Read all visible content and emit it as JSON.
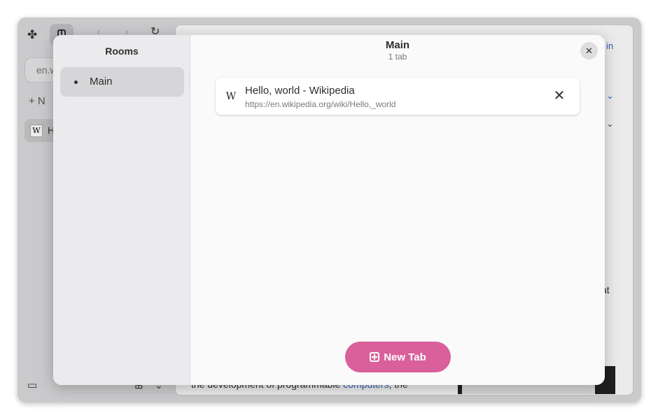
{
  "background": {
    "url_field": "en.w",
    "new_tab_row": "+ N",
    "tab_title": "H",
    "tab_favicon": "W",
    "content_text_prefix": "the development of programmable ",
    "content_text_link": "computers",
    "content_text_suffix": ", the",
    "right_link_1": "in",
    "right_link_2": "s ⌄",
    "right_text_3": "s ⌄",
    "right_text_4": "at"
  },
  "dialog": {
    "rooms_title": "Rooms",
    "rooms": [
      {
        "label": "Main",
        "selected": true
      }
    ],
    "main_title": "Main",
    "main_subtitle": "1 tab",
    "tabs": [
      {
        "favicon": "W",
        "title": "Hello, world - Wikipedia",
        "url": "https://en.wikipedia.org/wiki/Hello,_world"
      }
    ],
    "new_tab_label": "New Tab"
  },
  "colors": {
    "accent": "#d9609a",
    "link": "#3366cc"
  }
}
